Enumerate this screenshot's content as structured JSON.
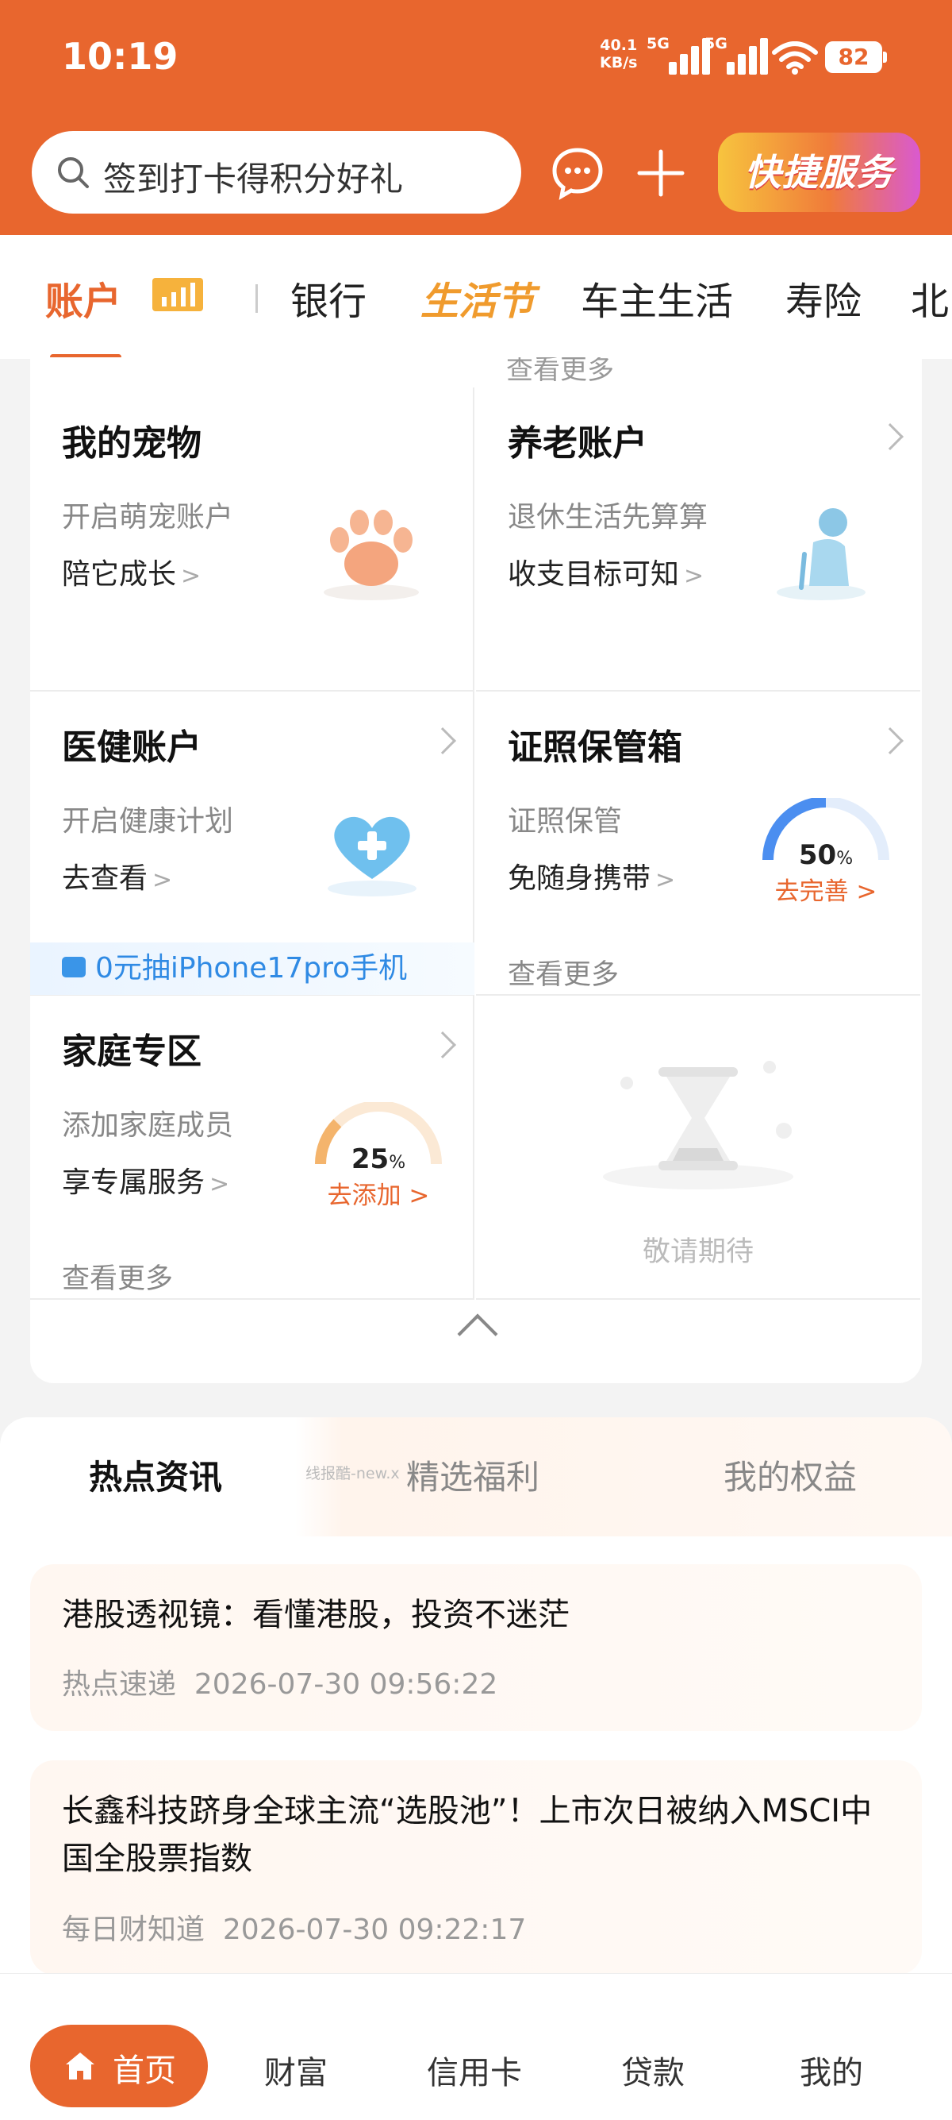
{
  "status_bar": {
    "time": "10:19",
    "net_speed_value": "40.1",
    "net_speed_unit": "KB/s",
    "signal1_label": "5G",
    "signal2_label": "5G",
    "battery": "82"
  },
  "header": {
    "search_placeholder": "签到打卡得积分好礼",
    "quick_service_label": "快捷服务",
    "accent_color": "#e8662e"
  },
  "tabs": [
    {
      "label": "账户"
    },
    {
      "label": "银行"
    },
    {
      "label": "生活节"
    },
    {
      "label": "车主生活"
    },
    {
      "label": "寿险"
    },
    {
      "label": "北"
    }
  ],
  "peek_more": "查看更多",
  "cards": {
    "pet": {
      "title": "我的宠物",
      "subtitle": "开启萌宠账户",
      "action": "陪它成长",
      "arrow": ">"
    },
    "pension": {
      "title": "养老账户",
      "subtitle": "退休生活先算算",
      "action": "收支目标可知",
      "arrow": ">"
    },
    "health": {
      "title": "医健账户",
      "subtitle": "开启健康计划",
      "action": "去查看",
      "arrow": ">",
      "promo": "0元抽iPhone17pro手机"
    },
    "documents": {
      "title": "证照保管箱",
      "subtitle": "证照保管",
      "action": "免随身携带",
      "arrow": ">",
      "more": "查看更多",
      "progress": 50,
      "progress_pct": "50",
      "progress_unit": "%",
      "progress_action": "去完善 >"
    },
    "family": {
      "title": "家庭专区",
      "subtitle": "添加家庭成员",
      "action": "享专属服务",
      "arrow": ">",
      "more": "查看更多",
      "progress": 25,
      "progress_pct": "25",
      "progress_unit": "%",
      "progress_action": "去添加 >"
    },
    "coming_soon": {
      "text": "敬请期待"
    }
  },
  "news_tabs": [
    {
      "label": "热点资讯"
    },
    {
      "label": "精选福利"
    },
    {
      "label": "我的权益"
    }
  ],
  "watermark": "线报酷-new.x",
  "news": [
    {
      "title": "港股透视镜：看懂港股，投资不迷茫",
      "source": "热点速递",
      "time": "2026-07-30 09:56:22"
    },
    {
      "title": "长鑫科技跻身全球主流“选股池”！上市次日被纳入MSCI中国全股票指数",
      "source": "每日财知道",
      "time": "2026-07-30 09:22:17"
    }
  ],
  "bottom_nav": [
    {
      "label": "首页"
    },
    {
      "label": "财富"
    },
    {
      "label": "信用卡"
    },
    {
      "label": "贷款"
    },
    {
      "label": "我的"
    }
  ]
}
